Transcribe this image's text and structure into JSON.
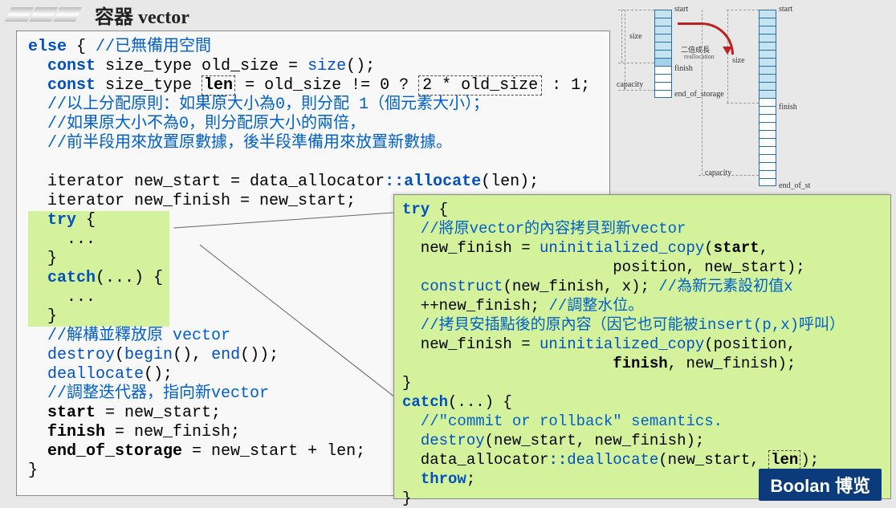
{
  "title": {
    "cn": "容器 ",
    "en": "vector"
  },
  "left": {
    "l1a": "else",
    "l1b": " { ",
    "l1c": "//已無備用空間",
    "l2a": "  const",
    "l2b": " size_type old_size = ",
    "l2c": "size",
    "l2d": "();",
    "l3a": "  const",
    "l3b": " size_type ",
    "l3c": "len",
    "l3d": " = old_size != 0 ? ",
    "l3e": "2 * old_size",
    "l3f": " : 1;",
    "l4": "  //以上分配原則：如果原大小為0，則分配 1（個元素大小）；",
    "l5": "  //如果原大小不為0，則分配原大小的兩倍，",
    "l6": "  //前半段用來放置原數據，後半段準備用來放置新數據。",
    "l8a": "  iterator new_start = data_allocator",
    "l8b": "::",
    "l8c": "allocate",
    "l8d": "(len);",
    "l9": "  iterator new_finish = new_start;",
    "l10": "  try {",
    "l11": "    ...",
    "l12": "  }",
    "l13": "  catch(...) {",
    "l14": "    ...",
    "l15": "  }",
    "l16": "  //解構並釋放原 vector",
    "l17a": "  ",
    "l17b": "destroy",
    "l17c": "(",
    "l17d": "begin",
    "l17e": "(), ",
    "l17f": "end",
    "l17g": "());",
    "l18a": "  ",
    "l18b": "deallocate",
    "l18c": "();",
    "l19": "  //調整迭代器，指向新vector",
    "l20a": "  ",
    "l20b": "start",
    "l20c": " = new_start;",
    "l21a": "  ",
    "l21b": "finish",
    "l21c": " = new_finish;",
    "l22a": "  ",
    "l22b": "end_of_storage",
    "l22c": " = new_start + len;",
    "l23": "}"
  },
  "right": {
    "l1": "try {",
    "l2": "  //將原vector的內容拷貝到新vector",
    "l3a": "  new_finish = ",
    "l3b": "uninitialized_copy",
    "l3c": "(",
    "l3d": "start",
    "l3e": ",",
    "l4a": "                       position, new_start);",
    "l5a": "  ",
    "l5b": "construct",
    "l5c": "(new_finish, x); ",
    "l5d": "//為新元素設初值x",
    "l6a": "  ++new_finish; ",
    "l6b": "//調整水位。",
    "l7": "  //拷貝安插點後的原內容（因它也可能被insert(p,x)呼叫）",
    "l8a": "  new_finish = ",
    "l8b": "uninitialized_copy",
    "l8c": "(position,",
    "l9": "                       finish, new_finish);",
    "l10": "}",
    "l11": "catch(...) {",
    "l12": "  //\"commit or rollback\" semantics.",
    "l13a": "  ",
    "l13b": "destroy",
    "l13c": "(new_start, new_finish);",
    "l14a": "  data_allocator",
    "l14b": "::",
    "l14c": "deallocate",
    "l14d": "(new_start, ",
    "l14e": "len",
    "l14f": ");",
    "l15": "  throw;",
    "l16": "}"
  },
  "diagram": {
    "start": "start",
    "size": "size",
    "capacity": "capacity",
    "finish": "finish",
    "end_of_storage": "end_of_storage",
    "end_of_st": "end_of_st",
    "realloc_cn": "二倍成長",
    "realloc_en": "reallocation"
  },
  "right_l9b": "finish",
  "logo": {
    "en": "Boolan",
    "cn": "博览"
  }
}
